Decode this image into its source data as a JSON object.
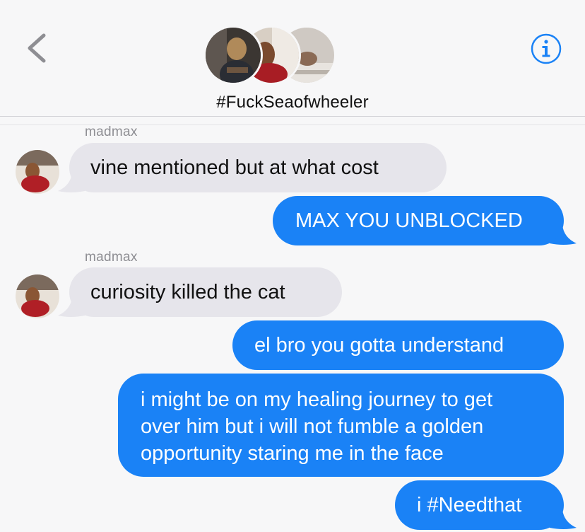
{
  "header": {
    "group_title": "#FuckSeaofwheeler",
    "back_icon": "chevron-left-icon",
    "info_icon": "info-circle-icon",
    "accent_color": "#1a82f6"
  },
  "messages": [
    {
      "direction": "incoming",
      "sender": "madmax",
      "text": "vine mentioned but at what cost"
    },
    {
      "direction": "outgoing",
      "text": "MAX YOU UNBLOCKED"
    },
    {
      "direction": "incoming",
      "sender": "madmax",
      "text": "curiosity killed the cat"
    },
    {
      "direction": "outgoing",
      "text": "el bro you gotta understand"
    },
    {
      "direction": "outgoing",
      "lines": [
        "i might be on my healing journey to get",
        "over him but i will not fumble a golden",
        "opportunity staring me in the face"
      ]
    },
    {
      "direction": "outgoing",
      "text": "i #Needthat"
    }
  ],
  "colors": {
    "incoming_bubble": "#e6e5eb",
    "outgoing_bubble": "#1a82f6",
    "background": "#f7f7f8"
  }
}
